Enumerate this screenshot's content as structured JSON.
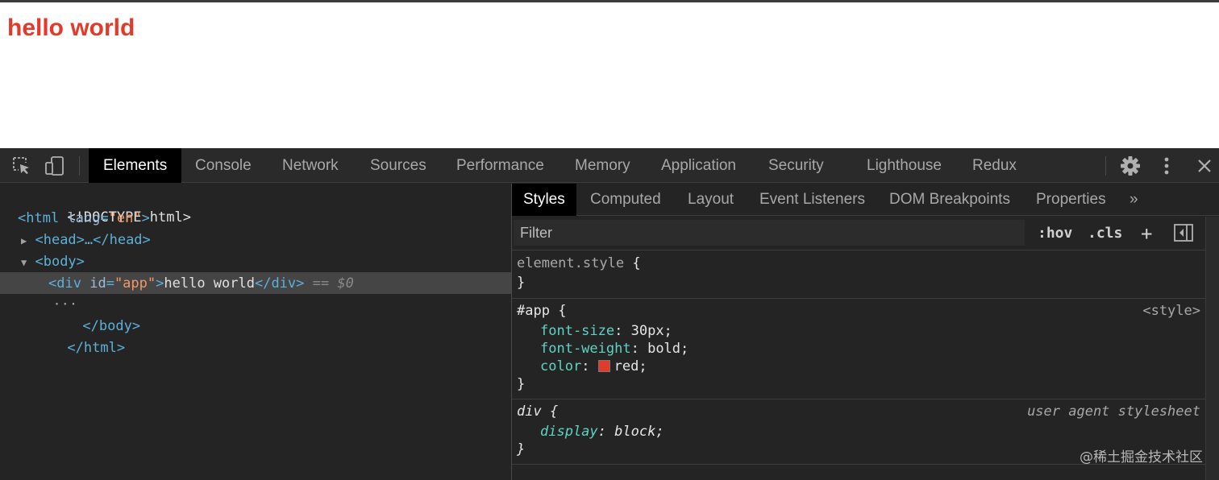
{
  "page": {
    "text": "hello world",
    "text_color": "#e23a2b"
  },
  "devtools": {
    "toolbar": {
      "icons": [
        "inspect-element-icon",
        "device-toggle-icon",
        "settings-gear-icon",
        "more-options-icon",
        "close-icon"
      ],
      "tabs": [
        "Elements",
        "Console",
        "Network",
        "Sources",
        "Performance",
        "Memory",
        "Application",
        "Security",
        "Lighthouse",
        "Redux"
      ],
      "active_tab": "Elements"
    },
    "dom_tree": {
      "doctype": "<!DOCTYPE html>",
      "html_open": "<html",
      "html_attr": "lang",
      "html_attr_value": "\"en\"",
      "head_collapsed": "<head>…</head>",
      "body_open": "<body>",
      "div_open": "<div",
      "div_attr": "id",
      "div_attr_value": "\"app\"",
      "div_text": "hello world",
      "div_close": "</div>",
      "selected_marker": "== $0",
      "gutter": "···",
      "body_close": "</body>",
      "html_close": "</html>"
    },
    "styles_pane": {
      "subtabs": [
        "Styles",
        "Computed",
        "Layout",
        "Event Listeners",
        "DOM Breakpoints",
        "Properties"
      ],
      "overflow_icon": "»",
      "active_subtab": "Styles",
      "filter_placeholder": "Filter",
      "hov_label": ":hov",
      "cls_label": ".cls",
      "add_rule_label": "+",
      "rules": [
        {
          "selector": "element.style",
          "open": "{",
          "close": "}",
          "origin": "",
          "properties": []
        },
        {
          "selector": "#app",
          "open": "{",
          "close": "}",
          "origin": "<style>",
          "properties": [
            {
              "name": "font-size",
              "value": "30px;"
            },
            {
              "name": "font-weight",
              "value": "bold;"
            },
            {
              "name": "color",
              "value": "red;",
              "swatch": "#e23a2b"
            }
          ]
        },
        {
          "selector": "div",
          "open": "{",
          "close": "}",
          "origin": "user agent stylesheet",
          "properties": [
            {
              "name": "display",
              "value": "block;"
            }
          ]
        }
      ]
    },
    "watermark": "@稀土掘金技术社区"
  }
}
